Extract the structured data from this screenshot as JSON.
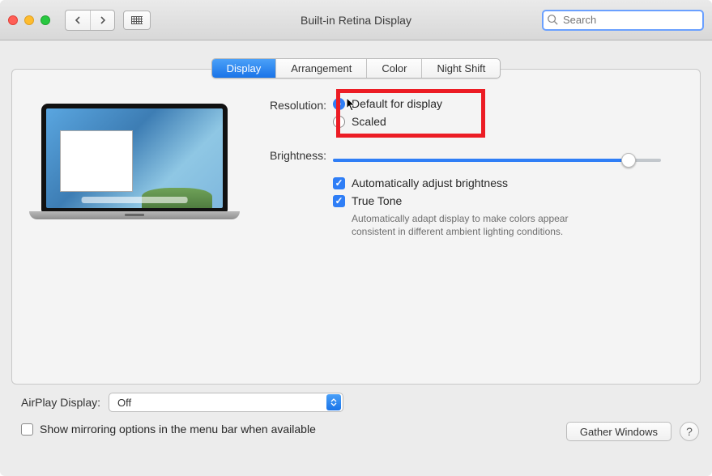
{
  "window": {
    "title": "Built-in Retina Display"
  },
  "toolbar": {
    "search_placeholder": "Search"
  },
  "tabs": {
    "display": "Display",
    "arrangement": "Arrangement",
    "color": "Color",
    "night_shift": "Night Shift",
    "active": "Display"
  },
  "settings": {
    "resolution_label": "Resolution:",
    "resolution_default": "Default for display",
    "resolution_scaled": "Scaled",
    "resolution_selected": "default",
    "brightness_label": "Brightness:",
    "brightness_value_pct": 90,
    "auto_brightness": "Automatically adjust brightness",
    "auto_brightness_checked": true,
    "true_tone": "True Tone",
    "true_tone_checked": true,
    "true_tone_desc": "Automatically adapt display to make colors appear consistent in different ambient lighting conditions."
  },
  "airplay": {
    "label": "AirPlay Display:",
    "value": "Off"
  },
  "footer": {
    "mirroring": "Show mirroring options in the menu bar when available",
    "mirroring_checked": false,
    "gather": "Gather Windows",
    "help": "?"
  },
  "annotation": {
    "highlight_target": "resolution-default-option"
  }
}
